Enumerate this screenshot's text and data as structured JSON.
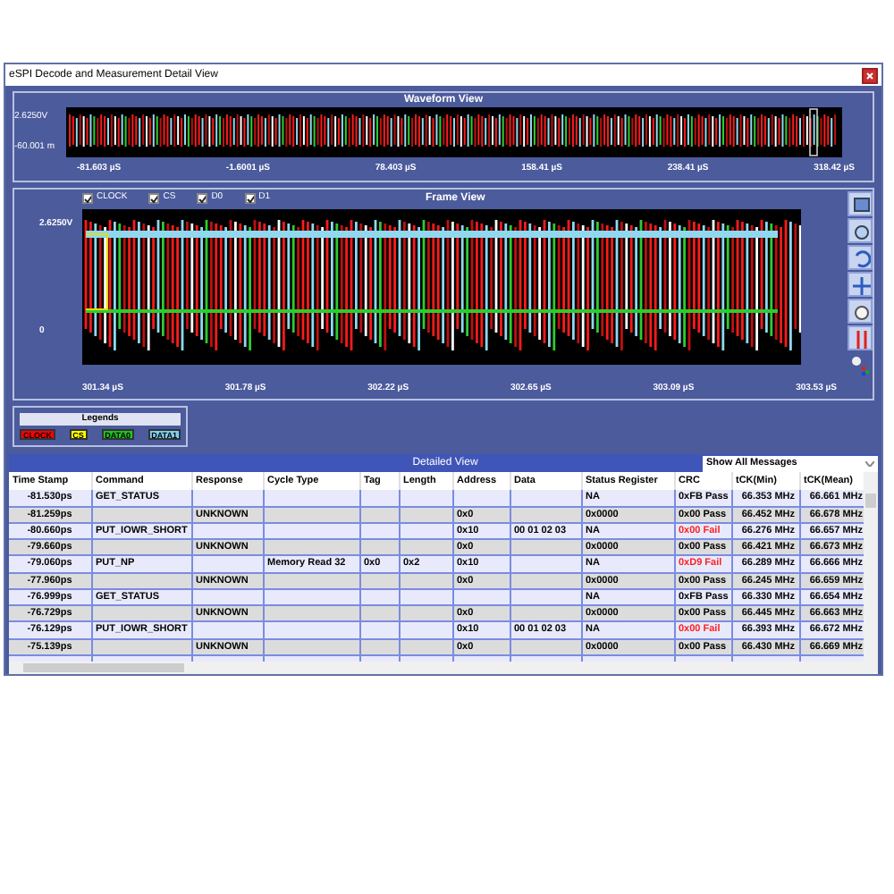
{
  "window": {
    "title": "eSPI Decode and Measurement Detail View"
  },
  "waveform_view": {
    "title": "Waveform View",
    "y_labels": [
      "2.6250V",
      "-60.001 m"
    ],
    "x_labels": [
      "-81.603 µS",
      "-1.6001 µS",
      "78.403 µS",
      "158.41 µS",
      "238.41 µS",
      "318.42 µS"
    ]
  },
  "frame_view": {
    "title": "Frame View",
    "channels": [
      {
        "label": "CLOCK",
        "checked": true
      },
      {
        "label": "CS",
        "checked": true
      },
      {
        "label": "D0",
        "checked": true
      },
      {
        "label": "D1",
        "checked": true
      }
    ],
    "y_labels": [
      "2.6250V",
      "0"
    ],
    "x_labels": [
      "301.34 µS",
      "301.78 µS",
      "302.22 µS",
      "302.65 µS",
      "303.09 µS",
      "303.53 µS"
    ]
  },
  "legends": {
    "title": "Legends",
    "items": [
      {
        "label": "CLOCK",
        "color": "#ff0000"
      },
      {
        "label": "CS",
        "color": "#ffff00"
      },
      {
        "label": "DATA0",
        "color": "#22c022"
      },
      {
        "label": "DATA1",
        "color": "#7fd0f0"
      }
    ]
  },
  "detailed_view": {
    "title": "Detailed View",
    "filter": "Show All Messages",
    "columns": [
      "Time Stamp",
      "Command",
      "Response",
      "Cycle Type",
      "Tag",
      "Length",
      "Address",
      "Data",
      "Status Register",
      "CRC",
      "tCK(Min)",
      "tCK(Mean)"
    ],
    "rows": [
      {
        "cells": [
          "-81.530ps",
          "GET_STATUS",
          "",
          "",
          "",
          "",
          "",
          "",
          "NA",
          "0xFB Pass",
          "66.353 MHz",
          "66.661 MHz"
        ],
        "crc_failed": false
      },
      {
        "cells": [
          "-81.259ps",
          "",
          "UNKNOWN",
          "",
          "",
          "",
          "0x0",
          "",
          "0x0000",
          "0x00 Pass",
          "66.452 MHz",
          "66.678 MHz"
        ],
        "crc_failed": false
      },
      {
        "cells": [
          "-80.660ps",
          "PUT_IOWR_SHORT",
          "",
          "",
          "",
          "",
          "0x10",
          "00 01 02 03",
          "NA",
          "0x00 Fail",
          "66.276 MHz",
          "66.657 MHz"
        ],
        "crc_failed": true
      },
      {
        "cells": [
          "-79.660ps",
          "",
          "UNKNOWN",
          "",
          "",
          "",
          "0x0",
          "",
          "0x0000",
          "0x00 Pass",
          "66.421 MHz",
          "66.673 MHz"
        ],
        "crc_failed": false
      },
      {
        "cells": [
          "-79.060ps",
          "PUT_NP",
          "",
          "Memory Read 32",
          "0x0",
          "0x2",
          "0x10",
          "",
          "NA",
          "0xD9 Fail",
          "66.289 MHz",
          "66.666 MHz"
        ],
        "crc_failed": true
      },
      {
        "cells": [
          "-77.960ps",
          "",
          "UNKNOWN",
          "",
          "",
          "",
          "0x0",
          "",
          "0x0000",
          "0x00 Pass",
          "66.245 MHz",
          "66.659 MHz"
        ],
        "crc_failed": false
      },
      {
        "cells": [
          "-76.999ps",
          "GET_STATUS",
          "",
          "",
          "",
          "",
          "",
          "",
          "NA",
          "0xFB Pass",
          "66.330 MHz",
          "66.654 MHz"
        ],
        "crc_failed": false
      },
      {
        "cells": [
          "-76.729ps",
          "",
          "UNKNOWN",
          "",
          "",
          "",
          "0x0",
          "",
          "0x0000",
          "0x00 Pass",
          "66.445 MHz",
          "66.663 MHz"
        ],
        "crc_failed": false
      },
      {
        "cells": [
          "-76.129ps",
          "PUT_IOWR_SHORT",
          "",
          "",
          "",
          "",
          "0x10",
          "00 01 02 03",
          "NA",
          "0x00 Fail",
          "66.393 MHz",
          "66.672 MHz"
        ],
        "crc_failed": true
      },
      {
        "cells": [
          "-75.139ps",
          "",
          "UNKNOWN",
          "",
          "",
          "",
          "0x0",
          "",
          "0x0000",
          "0x00 Pass",
          "66.430 MHz",
          "66.669 MHz"
        ],
        "crc_failed": false
      }
    ]
  }
}
